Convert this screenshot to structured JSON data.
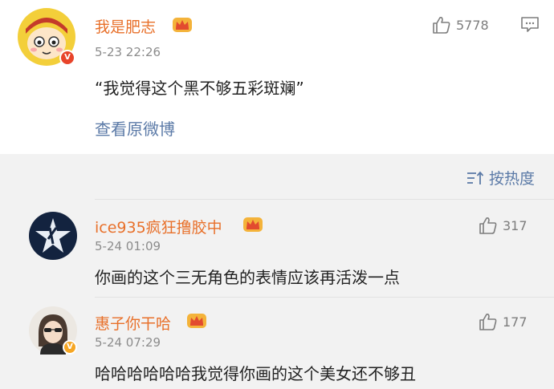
{
  "post": {
    "username": "我是肥志",
    "time": "5-23 22:26",
    "like_count": "5778",
    "text": "“我觉得这个黑不够五彩斑斓”",
    "view_original": "查看原微博"
  },
  "sort": {
    "label": "按热度"
  },
  "comments": [
    {
      "username": "ice935疯狂撸胶中",
      "time": "5-24 01:09",
      "like_count": "317",
      "text": "你画的这个三无角色的表情应该再活泼一点"
    },
    {
      "username": "惠子你干哈",
      "time": "5-24 07:29",
      "like_count": "177",
      "text": "哈哈哈哈哈哈我觉得你画的这个美女还不够丑"
    }
  ],
  "colors": {
    "username": "#e8702a",
    "link": "#5b7aa7",
    "background": "#f2f2f2",
    "card": "#ffffff"
  },
  "icons": [
    "thumbs-up-icon",
    "comment-icon",
    "sort-icon",
    "crown-badge-icon",
    "verified-badge-icon"
  ]
}
